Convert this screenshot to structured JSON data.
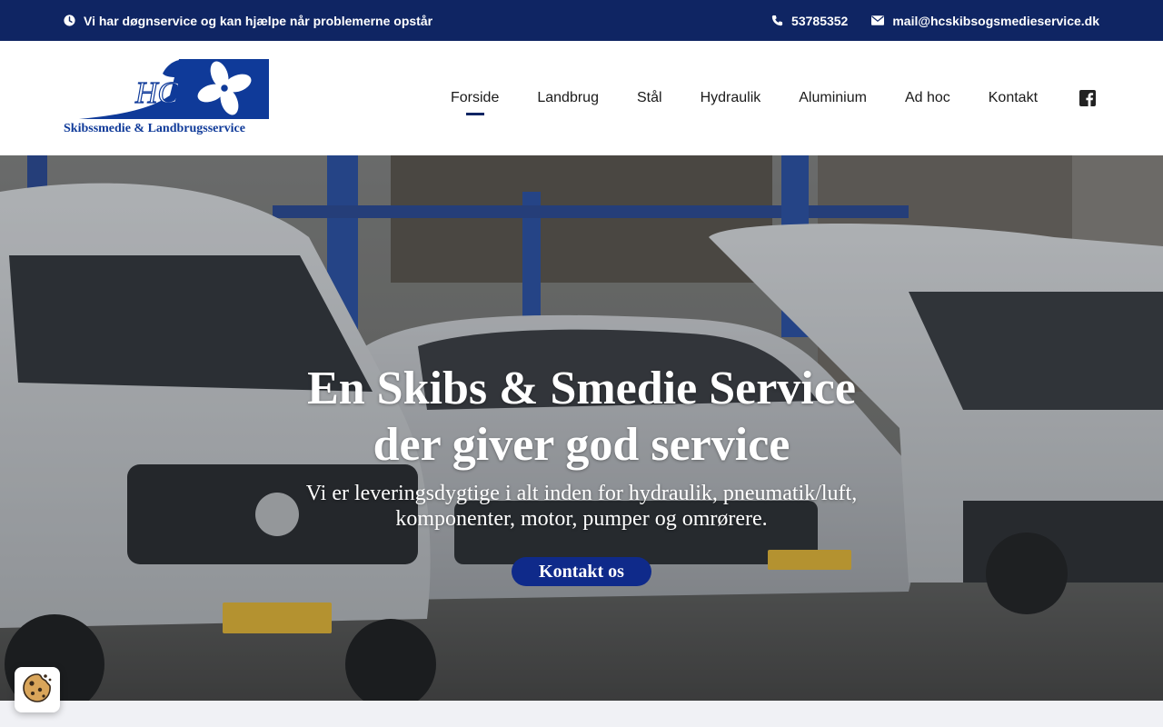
{
  "topbar": {
    "service_text": "Vi har døgnservice og kan hjælpe når problemerne opstår",
    "phone": "53785352",
    "email": "mail@hcskibsogsmedieservice.dk",
    "clock_icon": "clock-icon",
    "phone_icon": "phone-icon",
    "mail_icon": "envelope-icon"
  },
  "logo": {
    "initials": "HC",
    "company_name": "Skibssmedie & Landbrugsservice"
  },
  "nav": {
    "items": [
      {
        "label": "Forside",
        "active": true
      },
      {
        "label": "Landbrug",
        "active": false
      },
      {
        "label": "Stål",
        "active": false
      },
      {
        "label": "Hydraulik",
        "active": false
      },
      {
        "label": "Aluminium",
        "active": false
      },
      {
        "label": "Ad hoc",
        "active": false
      },
      {
        "label": "Kontakt",
        "active": false
      }
    ],
    "social_icon": "facebook-icon"
  },
  "hero": {
    "title_line1": "En Skibs & Smedie Service",
    "title_line2": "der giver god service",
    "subtitle_line1": "Vi er leveringsdygtige i alt inden for hydraulik, pneumatik/luft,",
    "subtitle_line2": "komponenter, motor, pumper og omrørere.",
    "button_label": "Kontakt os"
  },
  "colors": {
    "topbar_bg": "#0f2563",
    "accent": "#0f2a8a",
    "header_bg": "#ffffff"
  },
  "cookie": {
    "icon": "cookie-icon"
  }
}
